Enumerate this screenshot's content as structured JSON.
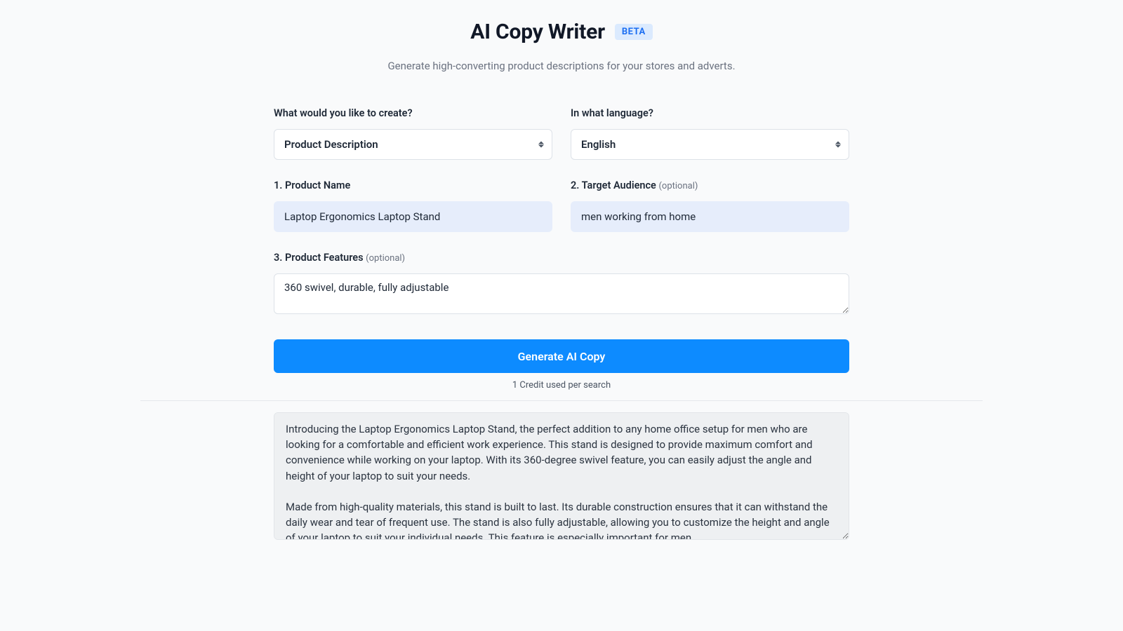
{
  "header": {
    "title": "AI Copy Writer",
    "badge": "BETA",
    "subtitle": "Generate high-converting product descriptions for your stores and adverts."
  },
  "form": {
    "create_label": "What would you like to create?",
    "create_value": "Product Description",
    "language_label": "In what language?",
    "language_value": "English",
    "product_name_label": "1. Product Name",
    "product_name_value": "Laptop Ergonomics Laptop Stand",
    "target_audience_label": "2. Target Audience ",
    "target_audience_optional": "(optional)",
    "target_audience_value": "men working from home",
    "features_label": "3. Product Features ",
    "features_optional": "(optional)",
    "features_value": "360 swivel, durable, fully adjustable",
    "generate_button": "Generate AI Copy",
    "credit_note": "1 Credit used per search"
  },
  "output": {
    "text": "Introducing the Laptop Ergonomics Laptop Stand, the perfect addition to any home office setup for men who are looking for a comfortable and efficient work experience. This stand is designed to provide maximum comfort and convenience while working on your laptop. With its 360-degree swivel feature, you can easily adjust the angle and height of your laptop to suit your needs.\n\nMade from high-quality materials, this stand is built to last. Its durable construction ensures that it can withstand the daily wear and tear of frequent use. The stand is also fully adjustable, allowing you to customize the height and angle of your laptop to suit your individual needs. This feature is especially important for men"
  }
}
